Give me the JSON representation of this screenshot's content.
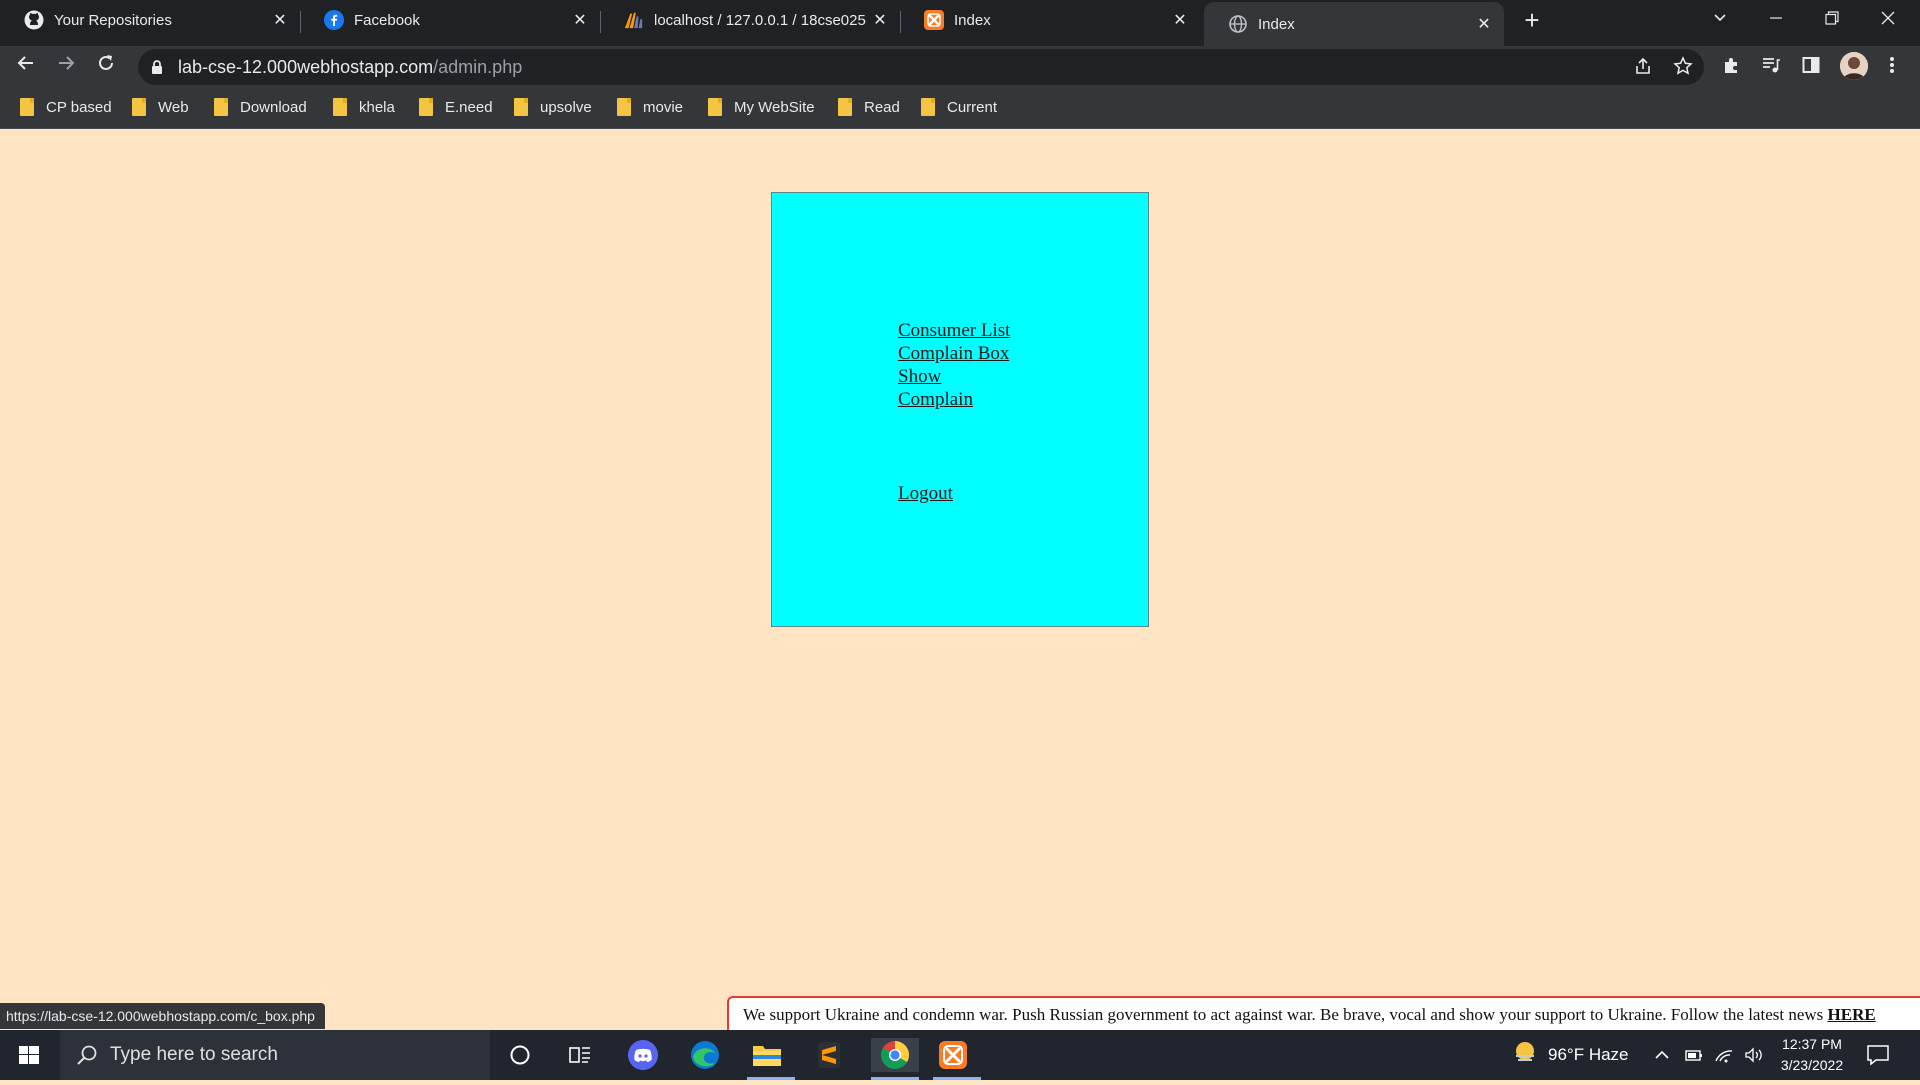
{
  "browser": {
    "tabs": [
      {
        "title": "Your Repositories",
        "icon": "github-icon"
      },
      {
        "title": "Facebook",
        "icon": "facebook-icon"
      },
      {
        "title": "localhost / 127.0.0.1 / 18cse025 |",
        "icon": "phpmyadmin-icon"
      },
      {
        "title": "Index",
        "icon": "xampp-icon"
      },
      {
        "title": "Index",
        "icon": "globe-icon",
        "active": true
      }
    ],
    "address": {
      "domain": "lab-cse-12.000webhostapp.com",
      "path": "/admin.php"
    },
    "bookmarks": [
      "CP based",
      "Web",
      "Download",
      "khela",
      "E.need",
      "upsolve",
      "movie",
      "My WebSite",
      "Read",
      "Current"
    ]
  },
  "page": {
    "menu": [
      "Consumer List",
      "Complain Box",
      "Show",
      "Complain"
    ],
    "logout": "Logout",
    "colors": {
      "background": "#ffe4c4",
      "panel": "#00ffff"
    }
  },
  "status_url": "https://lab-cse-12.000webhostapp.com/c_box.php",
  "banner": {
    "text": "We support Ukraine and condemn war. Push Russian government to act against war. Be brave, vocal and show your support to Ukraine. Follow the latest news ",
    "link": "HERE"
  },
  "taskbar": {
    "search_placeholder": "Type here to search",
    "weather": "96°F  Haze",
    "time": "12:37 PM",
    "date": "3/23/2022"
  }
}
